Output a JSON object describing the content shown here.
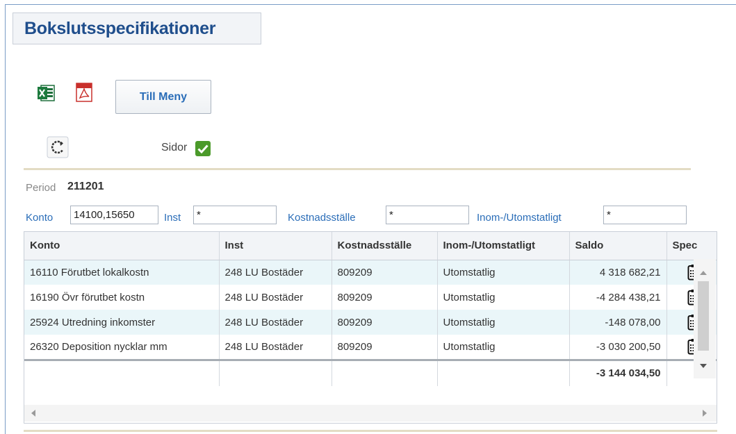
{
  "page": {
    "title": "Bokslutsspecifikationer"
  },
  "toolbar": {
    "excel_icon": "excel-icon",
    "pdf_icon": "pdf-icon",
    "menu_label": "Till Meny",
    "refresh_icon": "refresh-icon",
    "sidor_label": "Sidor",
    "sidor_checked": true
  },
  "period": {
    "label": "Period",
    "value": "211201"
  },
  "filters": {
    "konto_label": "Konto",
    "konto_value": "14100,15650",
    "inst_label": "Inst",
    "inst_value": "*",
    "kostnadsstalle_label": "Kostnadsställe",
    "kostnadsstalle_value": "*",
    "inom_label": "Inom-/Utomstatligt",
    "inom_value": "*"
  },
  "table": {
    "columns": [
      "Konto",
      "Inst",
      "Kostnadsställe",
      "Inom-/Utomstatligt",
      "Saldo",
      "Spec"
    ],
    "rows": [
      [
        "16110 Förutbet lokalkostn",
        "248 LU Bostäder",
        "809209",
        "Utomstatlig",
        "4 318 682,21"
      ],
      [
        "16190 Övr förutbet kostn",
        "248 LU Bostäder",
        "809209",
        "Utomstatlig",
        "-4 284 438,21"
      ],
      [
        "25924 Utredning inkomster",
        "248 LU Bostäder",
        "809209",
        "Utomstatlig",
        "-148 078,00"
      ],
      [
        "26320 Deposition nycklar mm",
        "248 LU Bostäder",
        "809209",
        "Utomstatlig",
        "-3 030 200,50"
      ]
    ],
    "spec_icon": "clipboard-list-icon",
    "total": "-3 144 034,50"
  },
  "colors": {
    "title": "#1f4e8c",
    "link": "#2a6db8",
    "row_alt": "#eaf6f9",
    "header_bg": "#f2f4f7",
    "separator": "#e3dcc4",
    "check_green": "#4b9a2a"
  }
}
